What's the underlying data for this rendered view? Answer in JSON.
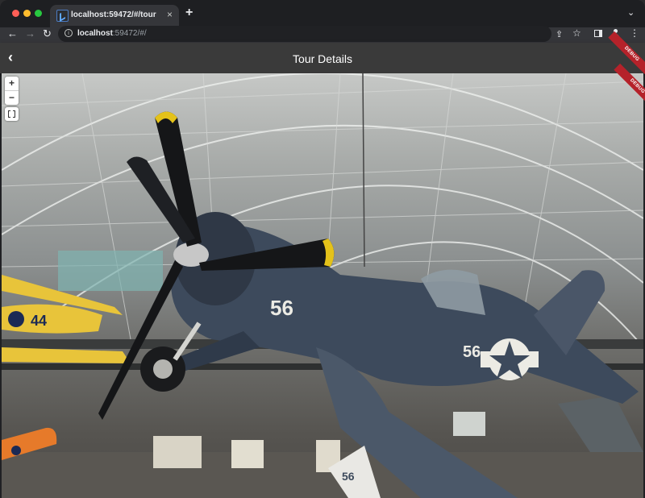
{
  "browser": {
    "tab_title": "localhost:59472/#/tour",
    "tab_close": "×",
    "new_tab": "+",
    "tab_menu": "⌄",
    "url_host": "localhost",
    "url_rest": ":59472/#/",
    "info": "i"
  },
  "icons": {
    "back": "←",
    "forward": "→",
    "reload": "↻",
    "share": "⇪",
    "star": "☆",
    "kebab": "⋮"
  },
  "appbar": {
    "title": "Tour Details",
    "back_glyph": "‹",
    "debug_label": "DEBUG"
  },
  "viewer": {
    "zoom_in": "+",
    "zoom_out": "−",
    "plane_number": "56",
    "yellow_plane_number": "44",
    "tail_number": "56",
    "colors": {
      "fuselage": "#3d4a5c",
      "prop": "#151618",
      "prop_tip": "#e4c21a",
      "yellow_plane": "#e8c43a",
      "orange_plane": "#e67a2a"
    }
  }
}
